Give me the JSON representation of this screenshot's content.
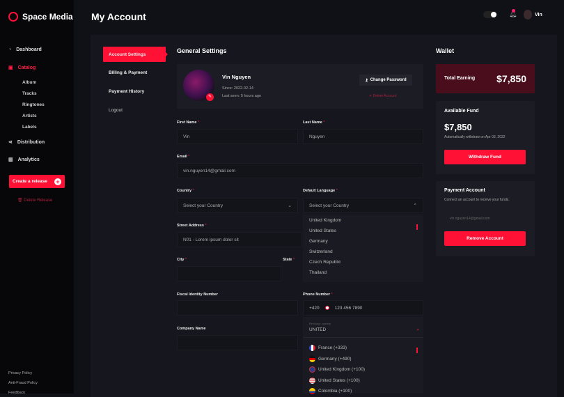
{
  "brand": {
    "name": "Space Media",
    "accent": "#ff1035"
  },
  "sidebar": {
    "items": [
      {
        "label": "Dashboard",
        "icon": "gauge-icon"
      },
      {
        "label": "Catalog",
        "icon": "catalog-icon",
        "active": true
      },
      {
        "label": "Distribution",
        "icon": "share-icon"
      },
      {
        "label": "Analytics",
        "icon": "bar-chart-icon"
      }
    ],
    "catalog_sub": [
      "Album",
      "Tracks",
      "Ringtones",
      "Artists",
      "Labels"
    ],
    "create_release": "Create a release",
    "delete_release": "Delete Release",
    "footer": [
      "Privacy Policy",
      "Anti-Fraud Policy",
      "Feedback"
    ]
  },
  "header": {
    "title": "My Account",
    "user": "Vin"
  },
  "tabs": [
    "Account Settings",
    "Billing & Payment",
    "Payment History",
    "Logout"
  ],
  "general": {
    "title": "General Settings",
    "name": "Vin Nguyen",
    "since": "Since: 2022-02-14",
    "last_seen": "Last seen: 5 hours ago",
    "change_password": "Change Password",
    "delete_account": "Delete Account",
    "first_name_label": "First Name",
    "first_name": "Vin",
    "last_name_label": "Last Name",
    "last_name": "Nguyen",
    "email_label": "Email",
    "email": "vin.nguyen14@gmail.com",
    "country_label": "Country",
    "country_placeholder": "Select your Country",
    "language_label": "Default Language",
    "language_placeholder": "Select your Country",
    "language_options": [
      "United Kingdom",
      "United States",
      "Germany",
      "Switzerland",
      "Czech Republic",
      "Thailand"
    ],
    "street_label": "Street Address",
    "street": "N01 - Lorem ipsum dolor sit",
    "city_label": "City",
    "state_label": "State",
    "fiscal_label": "Fiscal Identity Number",
    "company_label": "Company Name",
    "phone_label": "Phone Number",
    "phone_code": "+420",
    "phone": "123 456 7890",
    "find_country_label": "Find your country",
    "find_country": "UNITED",
    "phone_options": [
      "France (+333)",
      "Germany (+490)",
      "United Kingdom (+100)",
      "United States (+100)",
      "Colombia (+100)"
    ]
  },
  "wallet": {
    "title": "Wallet",
    "total_label": "Total Earning",
    "total": "$7,850",
    "available_label": "Available Fund",
    "available": "$7,850",
    "auto": "Automatically withdraw on Apr 03, 2022",
    "withdraw": "Withdraw Fund",
    "payment_title": "Payment Account",
    "payment_desc": "Connect an account to receive your funds.",
    "payment_email": "vin.nguyen14@gmail.com",
    "remove": "Remove Account"
  }
}
